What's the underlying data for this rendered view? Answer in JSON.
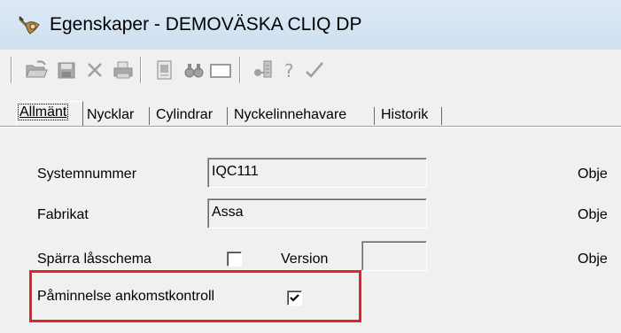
{
  "window": {
    "title": "Egenskaper - DEMOVÄSKA CLIQ DP"
  },
  "toolbar": {
    "buttons": [
      {
        "icon": "open-folder-icon"
      },
      {
        "icon": "save-icon"
      },
      {
        "icon": "delete-icon"
      },
      {
        "icon": "print-icon"
      },
      {
        "icon": "report-icon"
      },
      {
        "icon": "find-icon"
      },
      {
        "icon": "window-icon"
      },
      {
        "icon": "key-list-icon"
      },
      {
        "icon": "help-icon"
      },
      {
        "icon": "check-icon"
      }
    ]
  },
  "tabs": [
    {
      "label": "Allmänt",
      "active": true
    },
    {
      "label": "Nycklar",
      "active": false
    },
    {
      "label": "Cylindrar",
      "active": false
    },
    {
      "label": "Nyckelinnehavare",
      "active": false
    },
    {
      "label": "Historik",
      "active": false
    }
  ],
  "form": {
    "systemnummer": {
      "label": "Systemnummer",
      "value": "IQC111"
    },
    "fabrikat": {
      "label": "Fabrikat",
      "value": "Assa"
    },
    "sparra": {
      "label": "Spärra låsschema",
      "checked": false
    },
    "version": {
      "label": "Version",
      "value": ""
    },
    "paminnelse": {
      "label": "Påminnelse ankomstkontroll",
      "checked": true
    },
    "right_labels": [
      "Obje",
      "Obje",
      "Obje"
    ]
  },
  "colors": {
    "highlight": "#e32128",
    "titlebar": "#d6e4f3",
    "client": "#f0f0f0"
  }
}
